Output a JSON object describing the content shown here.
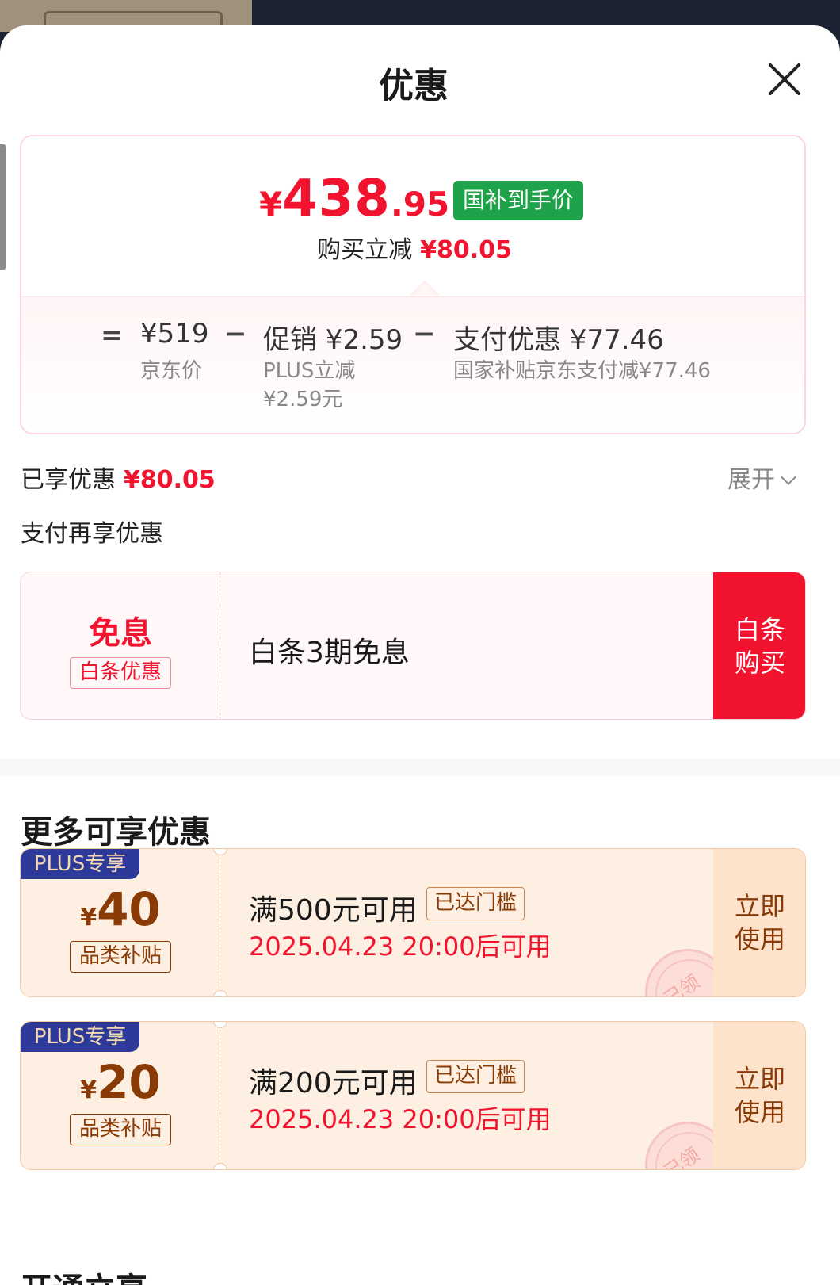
{
  "header": {
    "title": "优惠"
  },
  "price_card": {
    "final_symbol": "¥",
    "final_int": "438",
    "final_dec": ".95",
    "badge": "国补到手价",
    "reduce_label": "购买立减",
    "reduce_amount": "¥80.05",
    "formula": {
      "eq": "=",
      "jd_price": "¥519",
      "jd_price_label": "京东价",
      "minus1": "−",
      "promo_main": "促销 ¥2.59",
      "promo_sub1": "PLUS立减",
      "promo_sub2": "¥2.59元",
      "minus2": "−",
      "pay_main": "支付优惠 ¥77.46",
      "pay_sub": "国家补贴京东支付减¥77.46"
    }
  },
  "enjoyed": {
    "label": "已享优惠",
    "amount": "¥80.05",
    "expand": "展开"
  },
  "pay_more": "支付再享优惠",
  "baitiao": {
    "title_big": "免息",
    "tag": "白条优惠",
    "desc": "白条3期免息",
    "button_line1": "白条",
    "button_line2": "购买"
  },
  "more_title": "更多可享优惠",
  "coupons": [
    {
      "badge": "PLUS专享",
      "symbol": "¥",
      "amount": "40",
      "tag": "品类补贴",
      "condition": "满500元可用",
      "reached": "已达门槛",
      "time": "2025.04.23 20:00后可用",
      "btn1": "立即",
      "btn2": "使用",
      "stamp": "已领"
    },
    {
      "badge": "PLUS专享",
      "symbol": "¥",
      "amount": "20",
      "tag": "品类补贴",
      "condition": "满200元可用",
      "reached": "已达门槛",
      "time": "2025.04.23 20:00后可用",
      "btn1": "立即",
      "btn2": "使用",
      "stamp": "已领"
    }
  ],
  "bottom_cut_title": "开通立享",
  "colors": {
    "accent_red": "#f2142f",
    "green_badge": "#1fa34a",
    "plus_blue": "#2e3a99",
    "coupon_brown": "#8a3a05"
  }
}
